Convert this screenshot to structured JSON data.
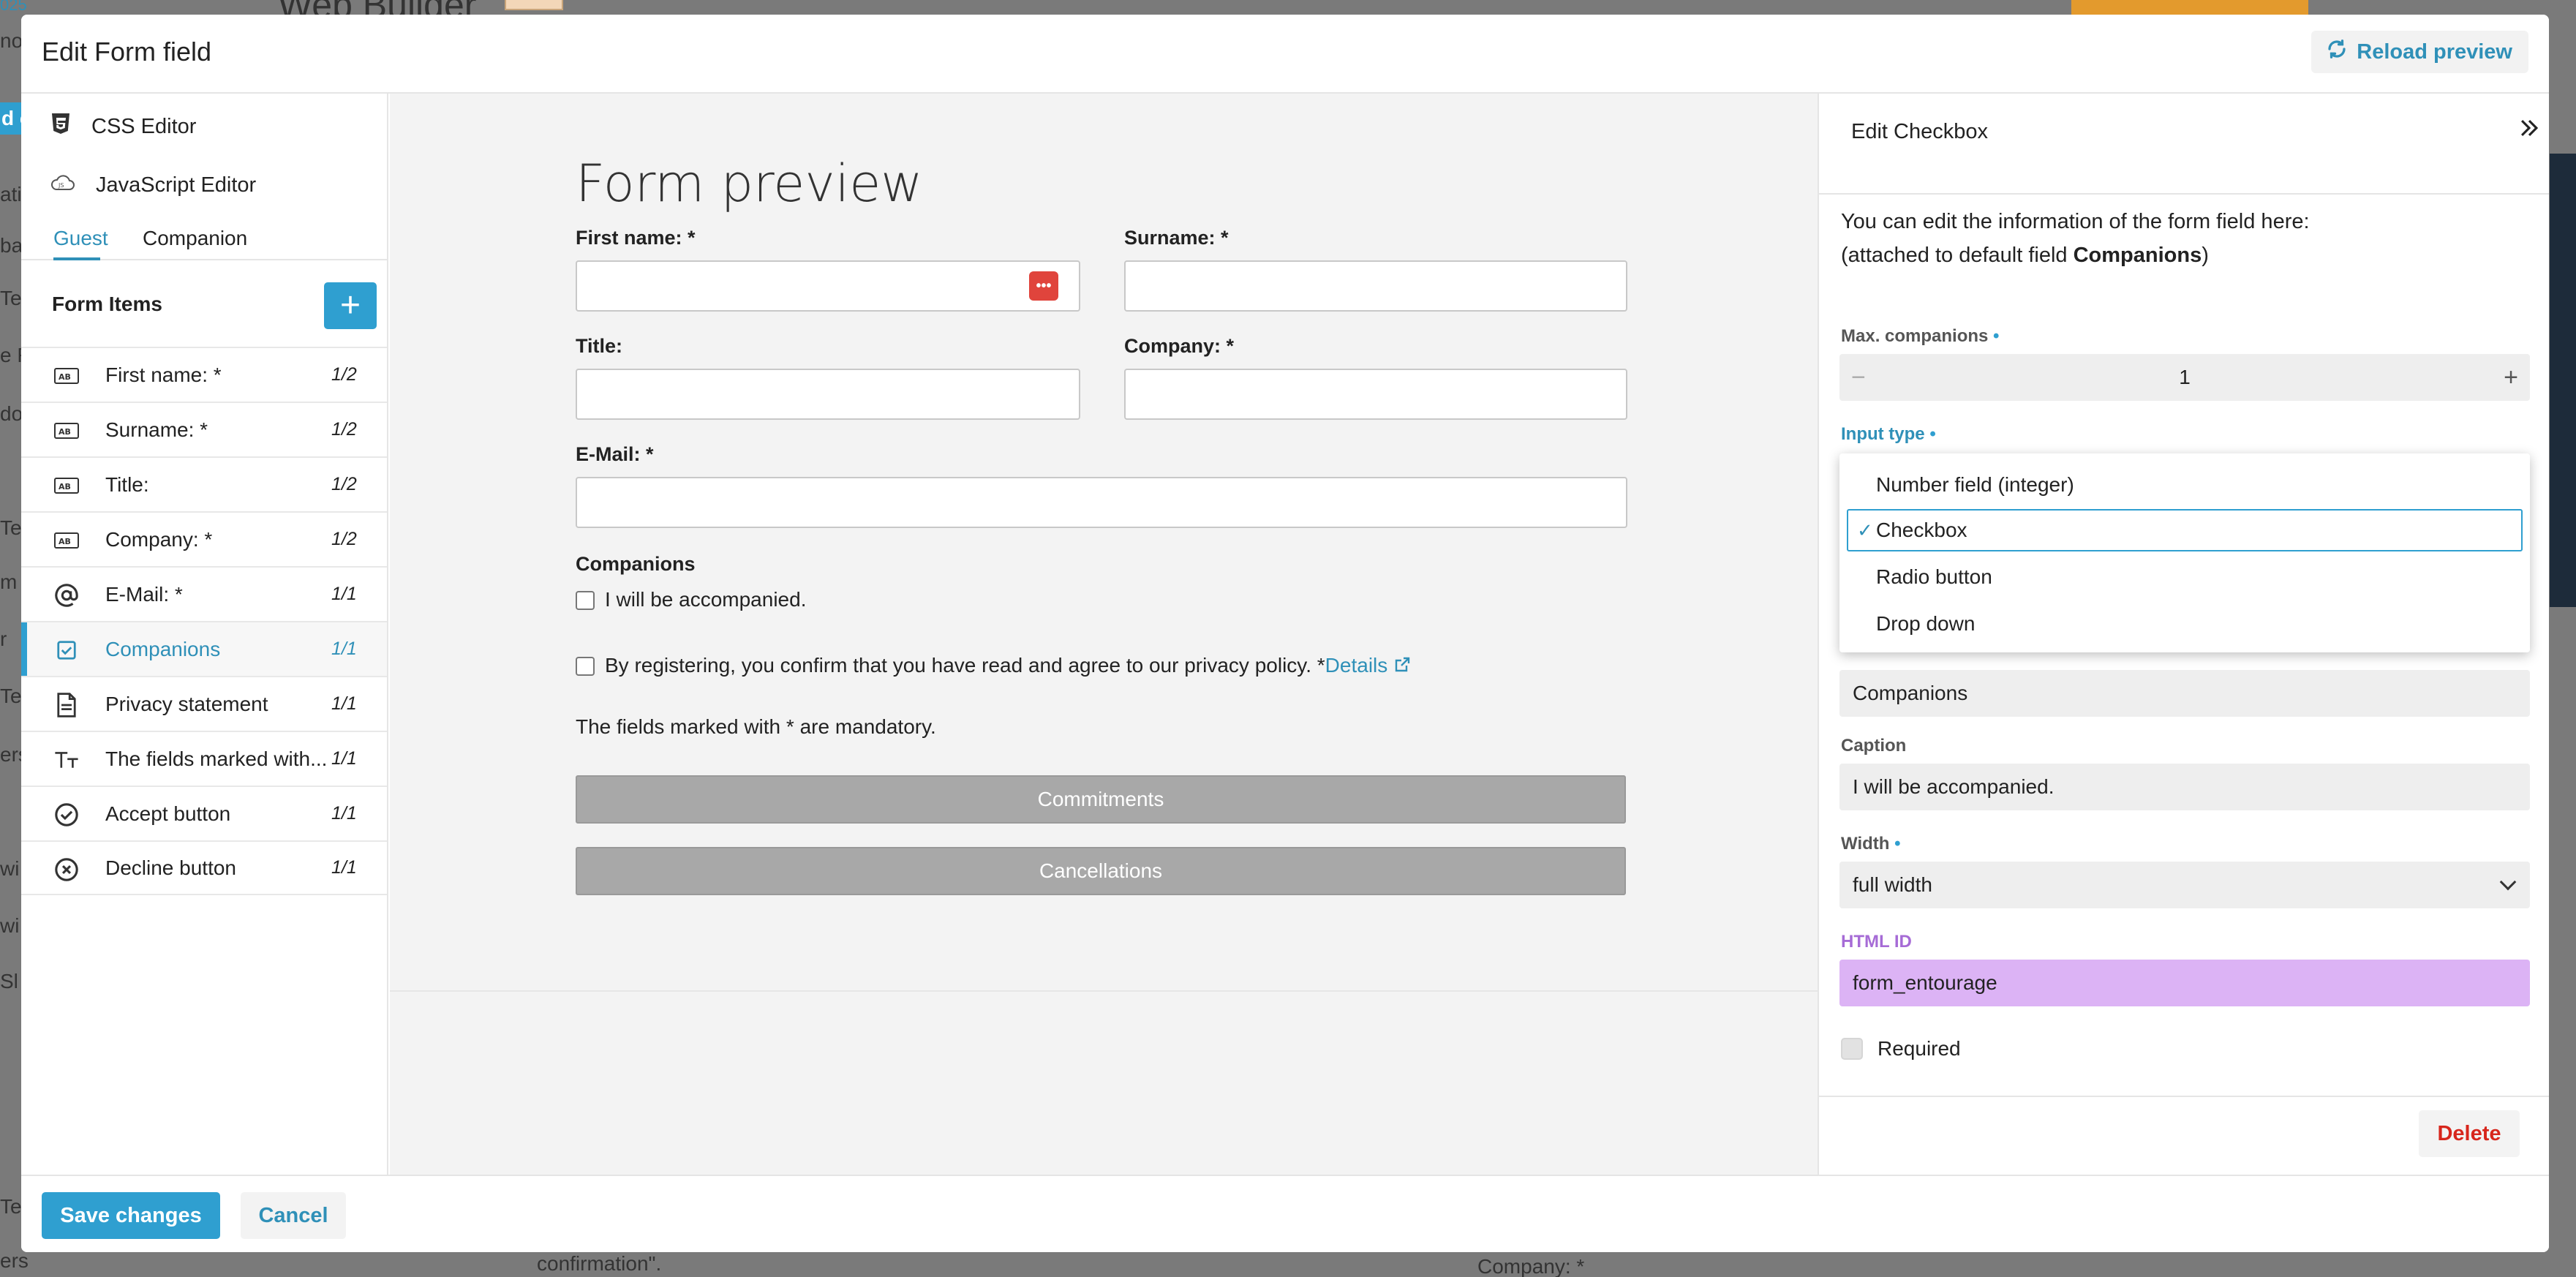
{
  "background": {
    "app_title": "Web Builder",
    "left_fragments": [
      "no",
      "d c",
      "atic",
      "ba",
      "Te",
      "e R",
      "dov",
      "Te",
      "m",
      "r",
      "Te",
      "ers",
      "wi",
      "wi",
      "Sl",
      "Te",
      "ers"
    ],
    "bottom_fragments": [
      "confirmation\".",
      "Company: *"
    ]
  },
  "modal": {
    "title": "Edit Form field",
    "reload_label": "Reload preview"
  },
  "left_panel": {
    "css_editor": "CSS Editor",
    "js_editor": "JavaScript Editor",
    "tabs": [
      {
        "label": "Guest"
      },
      {
        "label": "Companion"
      }
    ],
    "form_items_title": "Form Items",
    "add_label": "+",
    "items": [
      {
        "label": "First name: *",
        "size": "1/2",
        "icon": "text-field-icon"
      },
      {
        "label": "Surname: *",
        "size": "1/2",
        "icon": "text-field-icon"
      },
      {
        "label": "Title:",
        "size": "1/2",
        "icon": "text-field-icon"
      },
      {
        "label": "Company: *",
        "size": "1/2",
        "icon": "text-field-icon"
      },
      {
        "label": "E-Mail: *",
        "size": "1/1",
        "icon": "at-icon"
      },
      {
        "label": "Companions",
        "size": "1/1",
        "icon": "checkbox-icon"
      },
      {
        "label": "Privacy statement",
        "size": "1/1",
        "icon": "document-icon"
      },
      {
        "label": "The fields marked with...",
        "size": "1/1",
        "icon": "text-size-icon"
      },
      {
        "label": "Accept button",
        "size": "1/1",
        "icon": "check-circle-icon"
      },
      {
        "label": "Decline button",
        "size": "1/1",
        "icon": "x-circle-icon"
      }
    ]
  },
  "preview": {
    "title": "Form preview",
    "first_name_label": "First name: *",
    "surname_label": "Surname: *",
    "title_label": "Title:",
    "company_label": "Company: *",
    "email_label": "E-Mail: *",
    "companions_heading": "Companions",
    "companions_checkbox": "I will be accompanied.",
    "privacy_text": "By registering, you confirm that you have read and agree to our privacy policy. *",
    "details_link": "Details",
    "mandatory_note": "The fields marked with * are mandatory.",
    "commit_button": "Commitments",
    "cancel_button": "Cancellations",
    "password_icon_text": "•••"
  },
  "right_panel": {
    "title": "Edit Checkbox",
    "intro_line1": "You can edit the information of the form field here:",
    "intro_prefix": "(attached to default field ",
    "intro_bold": "Companions",
    "intro_suffix": ")",
    "max_companions_label": "Max. companions",
    "max_companions_value": "1",
    "input_type_label": "Input type",
    "input_type_options": [
      "Number field (integer)",
      "Checkbox",
      "Radio button",
      "Drop down"
    ],
    "input_type_selected": "Checkbox",
    "name_value": "Companions",
    "caption_label": "Caption",
    "caption_value": "I will be accompanied.",
    "width_label": "Width",
    "width_value": "full width",
    "html_id_label": "HTML ID",
    "html_id_value": "form_entourage",
    "required_label": "Required",
    "delete_label": "Delete"
  },
  "footer": {
    "save_label": "Save changes",
    "cancel_label": "Cancel"
  },
  "colors": {
    "accent": "#2f9fd0",
    "link": "#2f90b8",
    "danger": "#d7261c",
    "html_id_bg": "#dcb3f5"
  }
}
